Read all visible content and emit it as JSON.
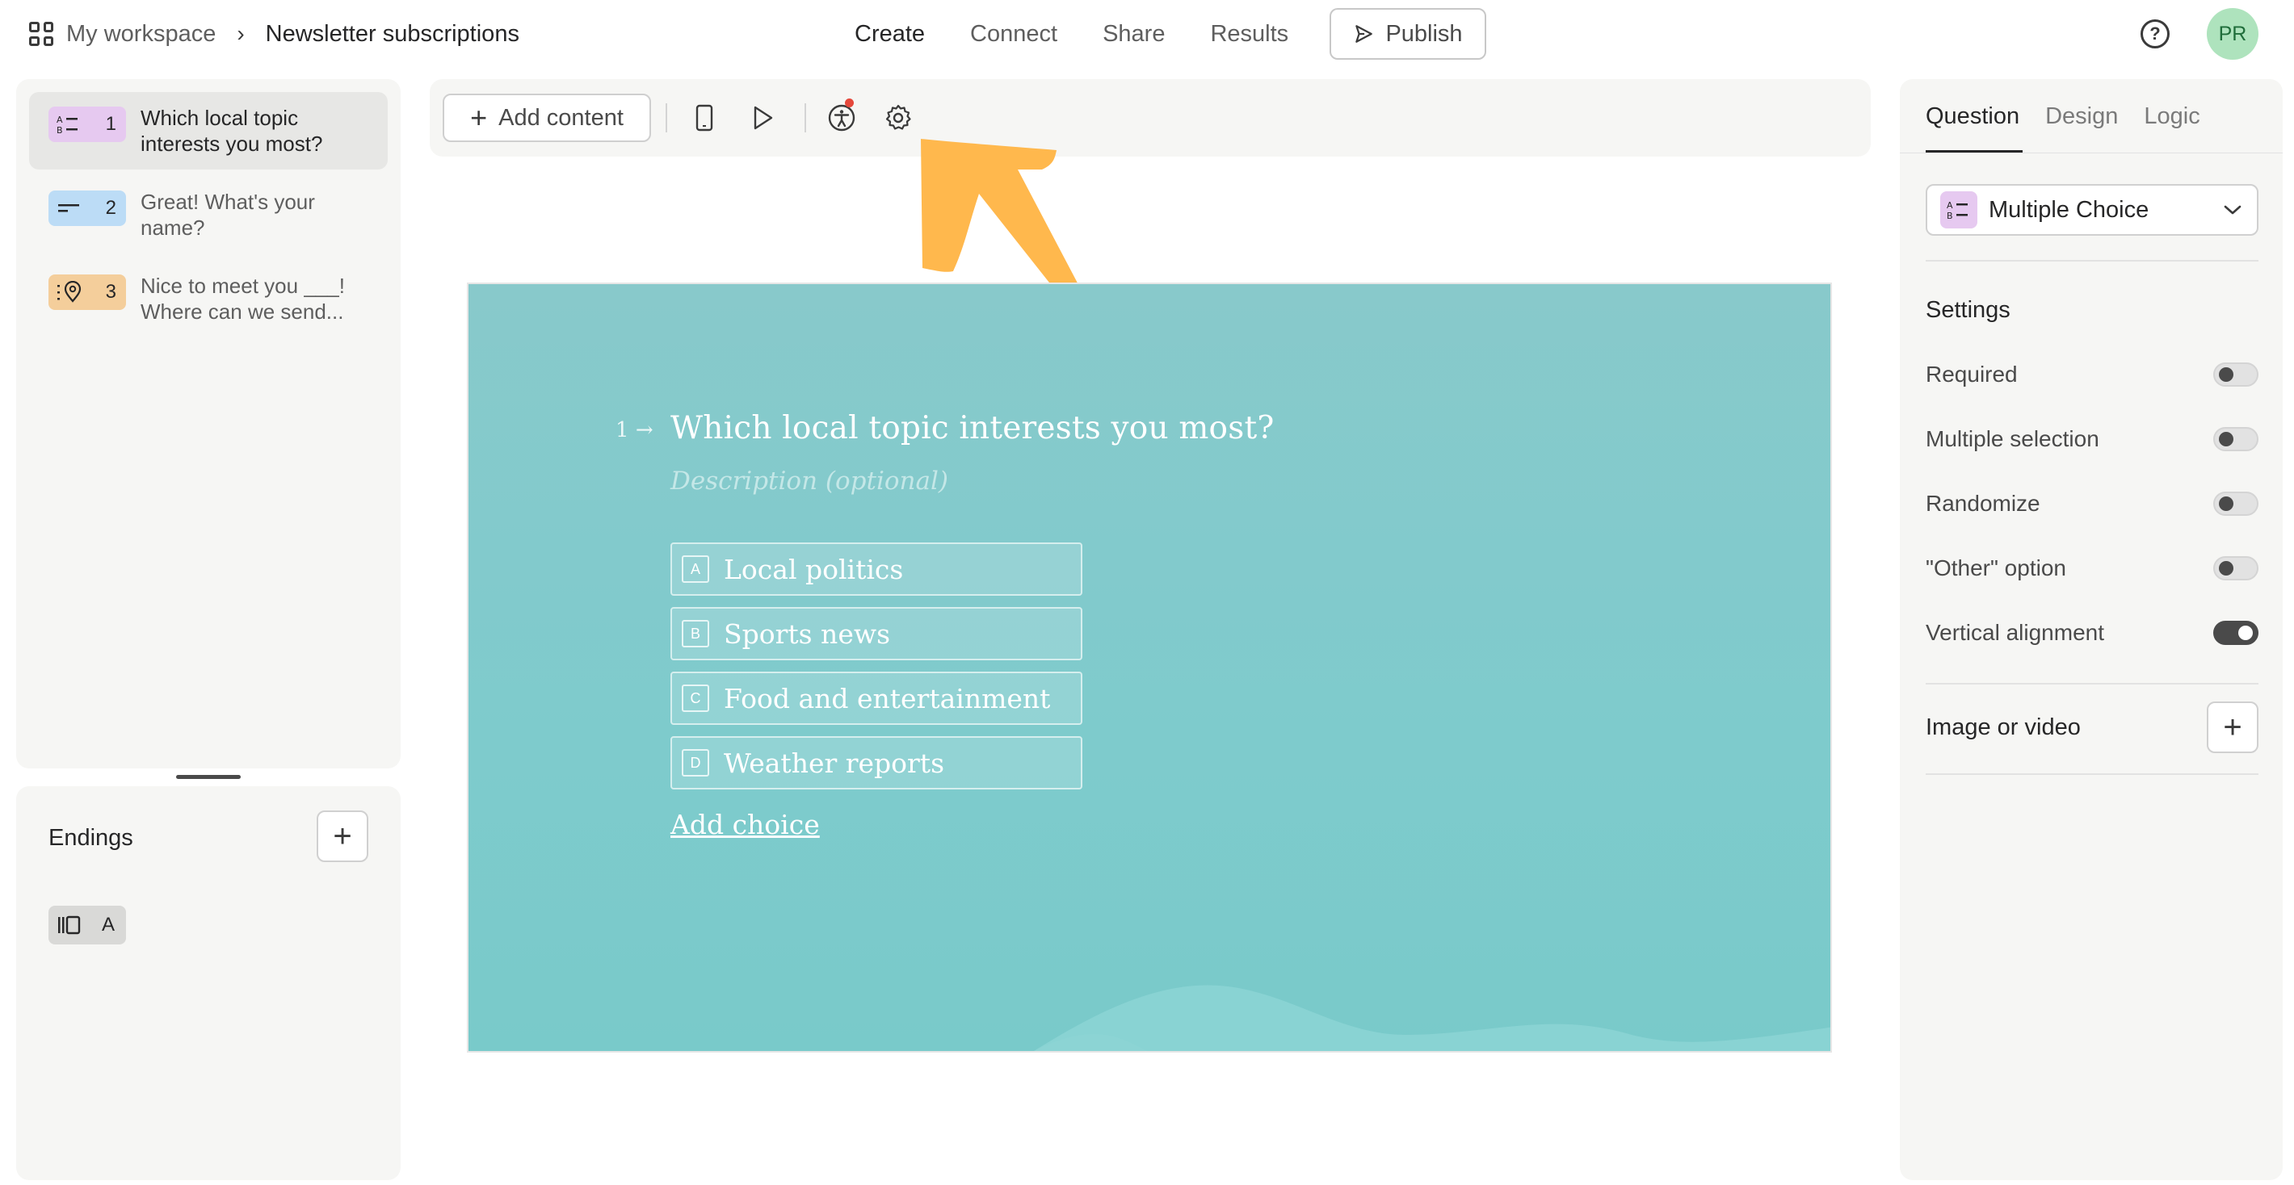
{
  "header": {
    "workspace": "My workspace",
    "separator": "›",
    "form_title": "Newsletter subscriptions",
    "nav": [
      "Create",
      "Connect",
      "Share",
      "Results"
    ],
    "active_nav": "Create",
    "publish_label": "Publish",
    "help_glyph": "?",
    "avatar_initials": "PR"
  },
  "questions": [
    {
      "number": "1",
      "text": "Which local topic interests you most?",
      "icon": "multiple-choice-icon",
      "color": "#e6c9f0",
      "active": true
    },
    {
      "number": "2",
      "text": "Great! What's your name?",
      "icon": "short-text-icon",
      "color": "#bcdcf6",
      "active": false
    },
    {
      "number": "3",
      "text": "Nice to meet you ___! Where can we send...",
      "icon": "address-icon",
      "color": "#f4ce9b",
      "active": false
    }
  ],
  "endings": {
    "title": "Endings",
    "add_glyph": "+",
    "items": [
      {
        "label": "A",
        "icon": "ending-icon"
      }
    ]
  },
  "toolbar": {
    "add_content_label": "Add content",
    "plus_glyph": "+"
  },
  "canvas": {
    "question_number": "1",
    "arrow_glyph": "→",
    "question_title": "Which local topic interests you most?",
    "description_placeholder": "Description (optional)",
    "choices": [
      {
        "key": "A",
        "label": "Local politics"
      },
      {
        "key": "B",
        "label": "Sports news"
      },
      {
        "key": "C",
        "label": "Food and entertainment"
      },
      {
        "key": "D",
        "label": "Weather reports"
      }
    ],
    "add_choice_label": "Add choice",
    "background_color": "#7ecbcc"
  },
  "annotation_arrow_color": "#ffb84d",
  "right_panel": {
    "tabs": [
      "Question",
      "Design",
      "Logic"
    ],
    "active_tab": "Question",
    "question_type": "Multiple Choice",
    "settings_title": "Settings",
    "settings": [
      {
        "label": "Required",
        "on": false
      },
      {
        "label": "Multiple selection",
        "on": false
      },
      {
        "label": "Randomize",
        "on": false
      },
      {
        "label": "\"Other\" option",
        "on": false
      },
      {
        "label": "Vertical alignment",
        "on": true
      }
    ],
    "image_video_label": "Image or video",
    "add_glyph": "+"
  }
}
